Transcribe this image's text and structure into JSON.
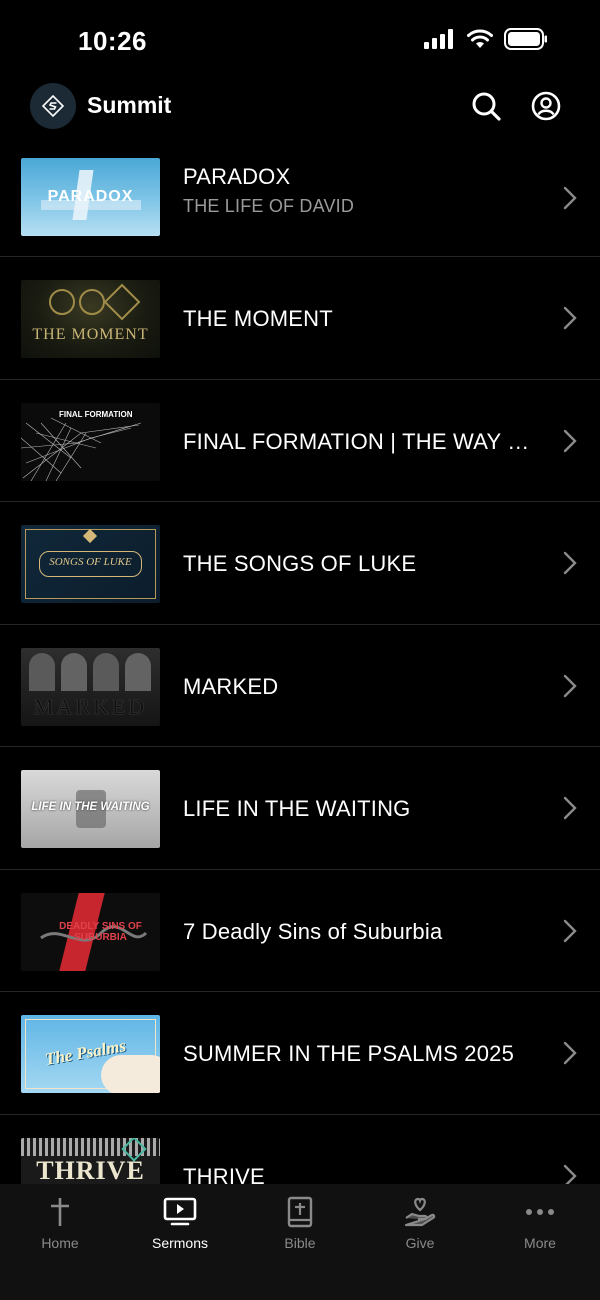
{
  "status_bar": {
    "time": "10:26"
  },
  "header": {
    "title": "Summit"
  },
  "series": [
    {
      "title": "PARADOX",
      "subtitle": "THE LIFE OF DAVID",
      "thumb_text": "PARADOX"
    },
    {
      "title": "THE MOMENT",
      "subtitle": "",
      "thumb_text": "THE MOMENT"
    },
    {
      "title": "FINAL FORMATION | THE WAY F...",
      "subtitle": "",
      "thumb_text": "FINAL FORMATION"
    },
    {
      "title": "THE SONGS OF LUKE",
      "subtitle": "",
      "thumb_text": "SONGS OF LUKE"
    },
    {
      "title": "MARKED",
      "subtitle": "",
      "thumb_text": "MARKED"
    },
    {
      "title": "LIFE IN THE WAITING",
      "subtitle": "",
      "thumb_text": "LIFE IN THE WAITING"
    },
    {
      "title": "7 Deadly Sins of Suburbia",
      "subtitle": "",
      "thumb_text": "DEADLY SINS OF SUBURBIA"
    },
    {
      "title": "SUMMER IN THE PSALMS 2025",
      "subtitle": "",
      "thumb_text": "The Psalms"
    },
    {
      "title": "THRIVE",
      "subtitle": "",
      "thumb_text": "THRIVE"
    }
  ],
  "tabs": [
    {
      "label": "Home",
      "icon": "cross-icon"
    },
    {
      "label": "Sermons",
      "icon": "tv-play-icon",
      "active": true
    },
    {
      "label": "Bible",
      "icon": "bible-icon"
    },
    {
      "label": "Give",
      "icon": "give-hand-heart-icon"
    },
    {
      "label": "More",
      "icon": "more-dots-icon"
    }
  ]
}
